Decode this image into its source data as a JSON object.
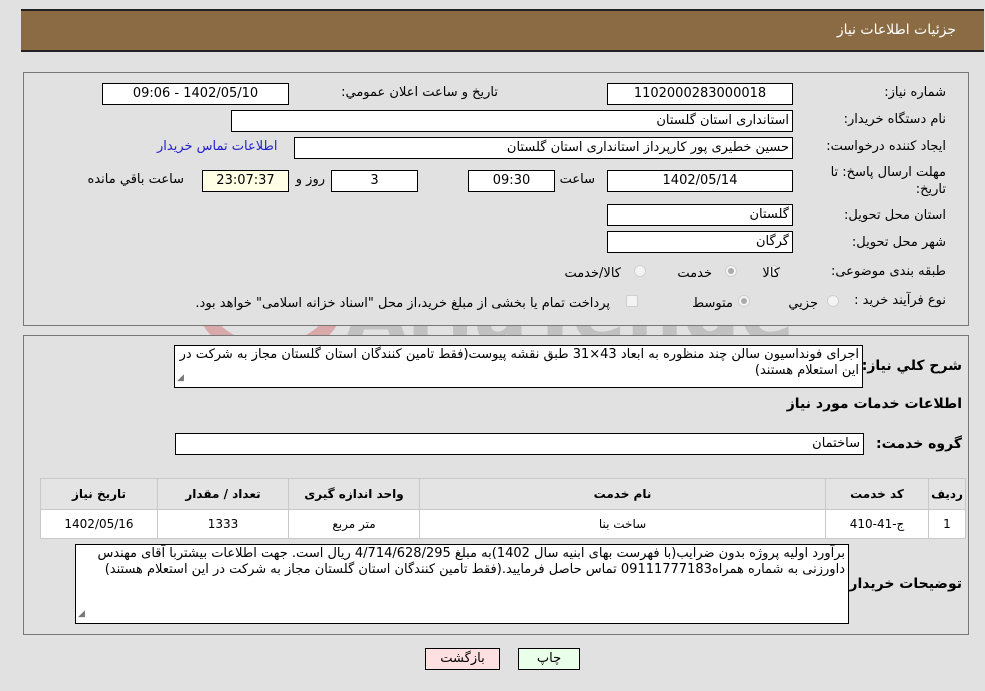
{
  "header": {
    "title": "جزئیات اطلاعات نیاز"
  },
  "form": {
    "need_number": {
      "label": "شماره نیاز:",
      "value": "1102000283000018"
    },
    "announce": {
      "label": "تاریخ و ساعت اعلان عمومي:",
      "value": "1402/05/10 - 09:06"
    },
    "buyer_org": {
      "label": "نام دستگاه خریدار:",
      "value": "استانداری استان گلستان"
    },
    "creator": {
      "label": "ایجاد کننده درخواست:",
      "value": "حسین خطیری پور کارپرداز استانداری استان گلستان",
      "contact_link": "اطلاعات تماس خریدار"
    },
    "deadline": {
      "label": "مهلت ارسال پاسخ: تا تاریخ:",
      "date": "1402/05/14",
      "time_label": "ساعت",
      "time": "09:30",
      "days": "3",
      "days_label": "روز و",
      "remaining": "23:07:37",
      "remaining_label": "ساعت باقي مانده"
    },
    "province": {
      "label": "استان محل تحویل:",
      "value": "گلستان"
    },
    "city": {
      "label": "شهر محل تحویل:",
      "value": "گرگان"
    },
    "category": {
      "label": "طبقه بندی موضوعی:",
      "options": [
        "کالا",
        "خدمت",
        "کالا/خدمت"
      ],
      "selected": "خدمت"
    },
    "purchase_type": {
      "label": "نوع فرآیند خرید :",
      "options": [
        "جزيي",
        "متوسط"
      ],
      "selected": "متوسط",
      "treasury_note": "پرداخت تمام یا بخشی از مبلغ خرید،از محل \"اسناد خزانه اسلامی\" خواهد بود.",
      "treasury_checked": false
    }
  },
  "details": {
    "description_label": "شرح كلي نياز:",
    "description": "اجرای فونداسیون سالن چند منظوره به ابعاد 43×31 طبق نقشه پیوست(فقط تامین کنندگان استان گلستان مجاز به شرکت در این استعلام هستند)",
    "services_heading": "اطلاعات خدمات مورد نياز",
    "service_group_label": "گروه خدمت:",
    "service_group": "ساختمان",
    "table": {
      "headers": [
        "رديف",
        "کد خدمت",
        "نام خدمت",
        "واحد اندازه گیری",
        "تعداد / مقدار",
        "تاریخ نیاز"
      ],
      "rows": [
        [
          "1",
          "ج-41-410",
          "ساخت بنا",
          "متر مربع",
          "1333",
          "1402/05/16"
        ]
      ]
    },
    "buyer_notes_label": "توضيحات خريدار:",
    "buyer_notes": "برآورد اولیه پروژه بدون ضرایب(با فهرست بهای ابنیه  سال 1402)به مبلغ 4/714/628/295 ریال است. جهت اطلاعات بیشتربا آقای  مهندس داورزنی به شماره همراه09111777183 تماس حاصل فرمایید.(فقط تامین کنندگان استان گلستان مجاز به شرکت در این استعلام هستند)"
  },
  "buttons": {
    "print": "چاپ",
    "back": "بازگشت"
  },
  "watermark": {
    "text": "AriaTender.net"
  }
}
